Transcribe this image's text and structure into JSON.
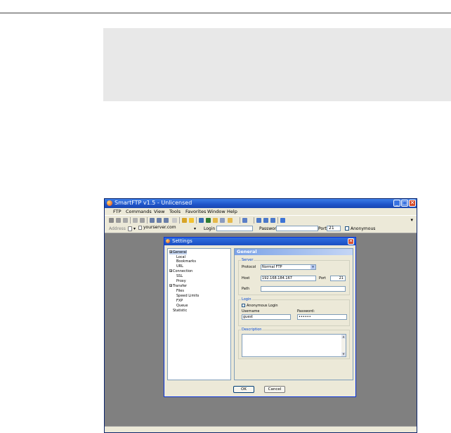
{
  "app": {
    "title": "SmartFTP v1.5 - Unlicensed",
    "menu": [
      "FTP",
      "Commands",
      "View",
      "Tools",
      "Favorites",
      "Window",
      "Help"
    ],
    "address_bar": {
      "address_label": "Address",
      "address_value": "yourserver.com",
      "login_label": "Login",
      "login_value": "",
      "password_label": "Password",
      "password_value": "",
      "port_label": "Port",
      "port_value": "21",
      "anonymous_label": "Anonymous"
    },
    "toolbar_icons": [
      "connect-icon",
      "disconnect-icon",
      "refresh-icon",
      "transfer-icon",
      "queue-icon",
      "list-icon",
      "list-icon",
      "list-icon",
      "ascii-icon",
      "favorites-icon",
      "star-icon",
      "save-icon",
      "stop-icon",
      "folder-icon",
      "view-icon",
      "folder-icon",
      "window-icon",
      "tile-icon",
      "tile-icon",
      "cascade-icon",
      "help-icon"
    ],
    "colors": {
      "titlebar": "#1f54c9",
      "workspace": "#808080",
      "dialog_bg": "#ece9d8",
      "accent": "#0046d5"
    }
  },
  "dialog": {
    "title": "Settings",
    "tree": [
      {
        "label": "General",
        "level": 0,
        "expander": "⊟",
        "selected": true
      },
      {
        "label": "Local",
        "level": 1
      },
      {
        "label": "Bookmarks",
        "level": 1
      },
      {
        "label": "URL",
        "level": 1
      },
      {
        "label": "Connection",
        "level": 0,
        "expander": "⊟"
      },
      {
        "label": "SSL",
        "level": 1
      },
      {
        "label": "Proxy",
        "level": 1
      },
      {
        "label": "Transfer",
        "level": 0,
        "expander": "⊟"
      },
      {
        "label": "Files",
        "level": 1
      },
      {
        "label": "Speed Limits",
        "level": 1
      },
      {
        "label": "FXP",
        "level": 1
      },
      {
        "label": "Queue",
        "level": 1
      },
      {
        "label": "Statistic",
        "level": 0
      }
    ],
    "panel_title": "General",
    "server": {
      "legend": "Server",
      "protocol_label": "Protocol",
      "protocol_value": "Normal FTP",
      "host_label": "Host",
      "host_value": "192.168.184.167",
      "port_label": "Port",
      "port_value": "21",
      "path_label": "Path",
      "path_value": ""
    },
    "login": {
      "legend": "Login",
      "anonymous_label": "Anonymous Login",
      "username_label": "Username",
      "username_value": "guest",
      "password_label": "Password:",
      "password_value": "••••••"
    },
    "description": {
      "legend": "Description",
      "value": ""
    },
    "ok_label": "OK",
    "cancel_label": "Cancel"
  }
}
